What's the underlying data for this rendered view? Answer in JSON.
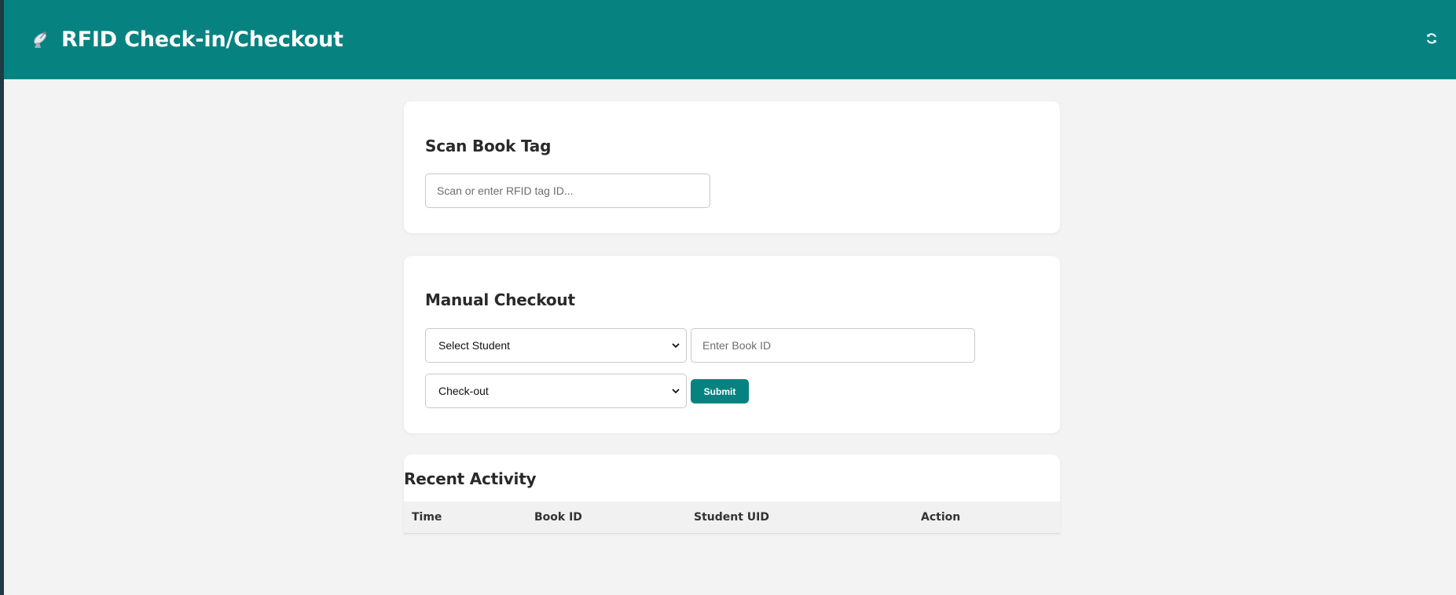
{
  "app": {
    "title": "RFID Check-in/Checkout",
    "brand_icon": "satellite-antenna-icon",
    "refresh_icon": "refresh-icon",
    "accent_color": "#068380"
  },
  "scan_card": {
    "heading": "Scan Book Tag",
    "input": {
      "placeholder": "Scan or enter RFID tag ID...",
      "value": ""
    }
  },
  "manual_card": {
    "heading": "Manual Checkout",
    "student_select": {
      "selected": "Select Student"
    },
    "book_input": {
      "placeholder": "Enter Book ID",
      "value": ""
    },
    "action_select": {
      "selected": "Check-out"
    },
    "submit_label": "Submit"
  },
  "activity": {
    "heading": "Recent Activity",
    "columns": [
      "Time",
      "Book ID",
      "Student UID",
      "Action"
    ],
    "rows": []
  }
}
